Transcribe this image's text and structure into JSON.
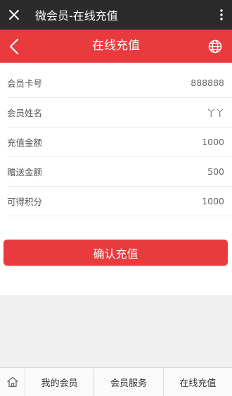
{
  "wechat_bar": {
    "title": "微会员-在线充值",
    "close_icon": "close-icon",
    "more_icon": "more-vertical-icon"
  },
  "header": {
    "title": "在线充值",
    "back_icon": "chevron-left-icon",
    "globe_icon": "globe-icon",
    "bg_color": "#e93b3d"
  },
  "info": [
    {
      "label": "会员卡号",
      "value": "888888"
    },
    {
      "label": "会员姓名",
      "value": "丫丫"
    },
    {
      "label": "充值金额",
      "value": "1000"
    },
    {
      "label": "赠送金额",
      "value": "500"
    },
    {
      "label": "可得积分",
      "value": "1000"
    }
  ],
  "confirm_button": "确认充值",
  "bottom_nav": {
    "home_icon": "home-icon",
    "items": [
      {
        "label": "我的会员"
      },
      {
        "label": "会员服务"
      },
      {
        "label": "在线充值"
      }
    ]
  }
}
